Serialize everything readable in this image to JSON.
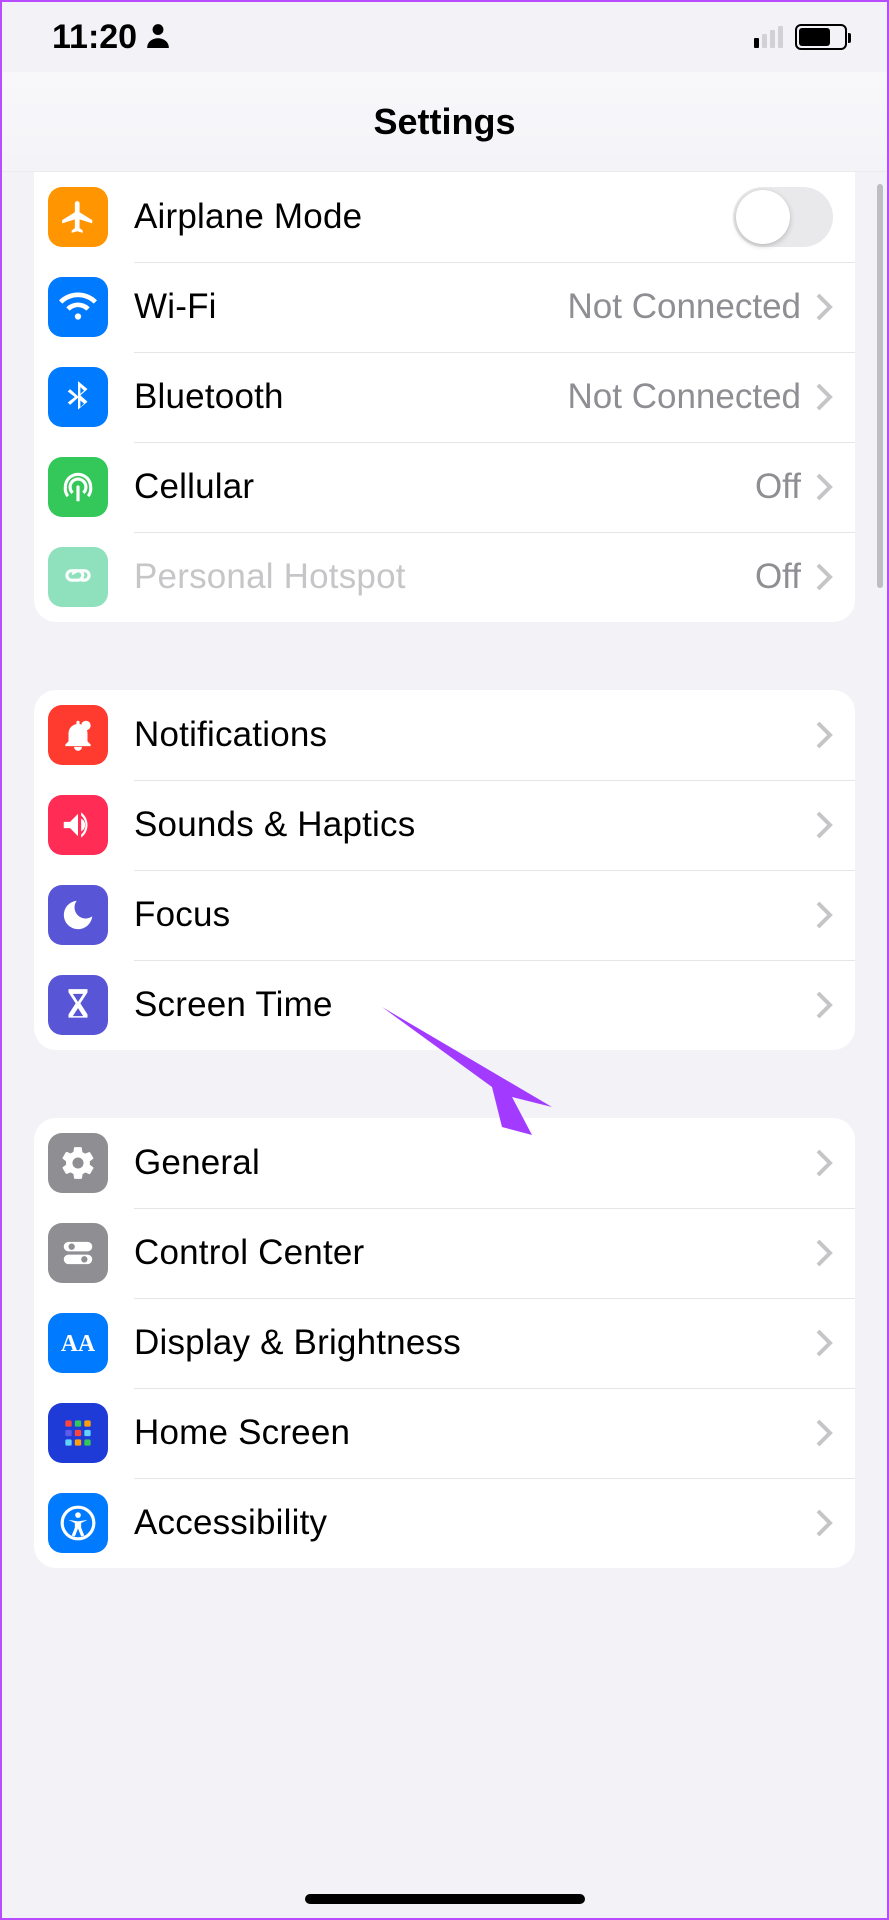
{
  "status": {
    "time": "11:20"
  },
  "header": {
    "title": "Settings"
  },
  "groups": [
    {
      "id": "connectivity",
      "items": [
        {
          "id": "airplane",
          "label": "Airplane Mode",
          "icon": "airplane-icon",
          "color": "#ff9500",
          "control": "toggle",
          "toggle_on": false
        },
        {
          "id": "wifi",
          "label": "Wi-Fi",
          "icon": "wifi-icon",
          "color": "#007aff",
          "control": "nav",
          "detail": "Not Connected"
        },
        {
          "id": "bluetooth",
          "label": "Bluetooth",
          "icon": "bluetooth-icon",
          "color": "#007aff",
          "control": "nav",
          "detail": "Not Connected"
        },
        {
          "id": "cellular",
          "label": "Cellular",
          "icon": "cellular-icon",
          "color": "#34c759",
          "control": "nav",
          "detail": "Off"
        },
        {
          "id": "hotspot",
          "label": "Personal Hotspot",
          "icon": "hotspot-icon",
          "color": "#8fe0bd",
          "control": "nav",
          "detail": "Off",
          "disabled": true
        }
      ]
    },
    {
      "id": "attention",
      "items": [
        {
          "id": "notifications",
          "label": "Notifications",
          "icon": "notifications-icon",
          "color": "#ff3b30",
          "control": "nav"
        },
        {
          "id": "sounds",
          "label": "Sounds & Haptics",
          "icon": "sounds-icon",
          "color": "#ff2d55",
          "control": "nav"
        },
        {
          "id": "focus",
          "label": "Focus",
          "icon": "focus-icon",
          "color": "#5856d6",
          "control": "nav"
        },
        {
          "id": "screentime",
          "label": "Screen Time",
          "icon": "screentime-icon",
          "color": "#5856d6",
          "control": "nav"
        }
      ]
    },
    {
      "id": "general-group",
      "items": [
        {
          "id": "general",
          "label": "General",
          "icon": "general-icon",
          "color": "#8e8e93",
          "control": "nav"
        },
        {
          "id": "controlcenter",
          "label": "Control Center",
          "icon": "controlcenter-icon",
          "color": "#8e8e93",
          "control": "nav"
        },
        {
          "id": "display",
          "label": "Display & Brightness",
          "icon": "display-icon",
          "color": "#007aff",
          "control": "nav"
        },
        {
          "id": "homescreen",
          "label": "Home Screen",
          "icon": "homescreen-icon",
          "color": "#1f3bd7",
          "control": "nav"
        },
        {
          "id": "accessibility",
          "label": "Accessibility",
          "icon": "accessibility-icon",
          "color": "#007aff",
          "control": "nav"
        }
      ]
    }
  ]
}
